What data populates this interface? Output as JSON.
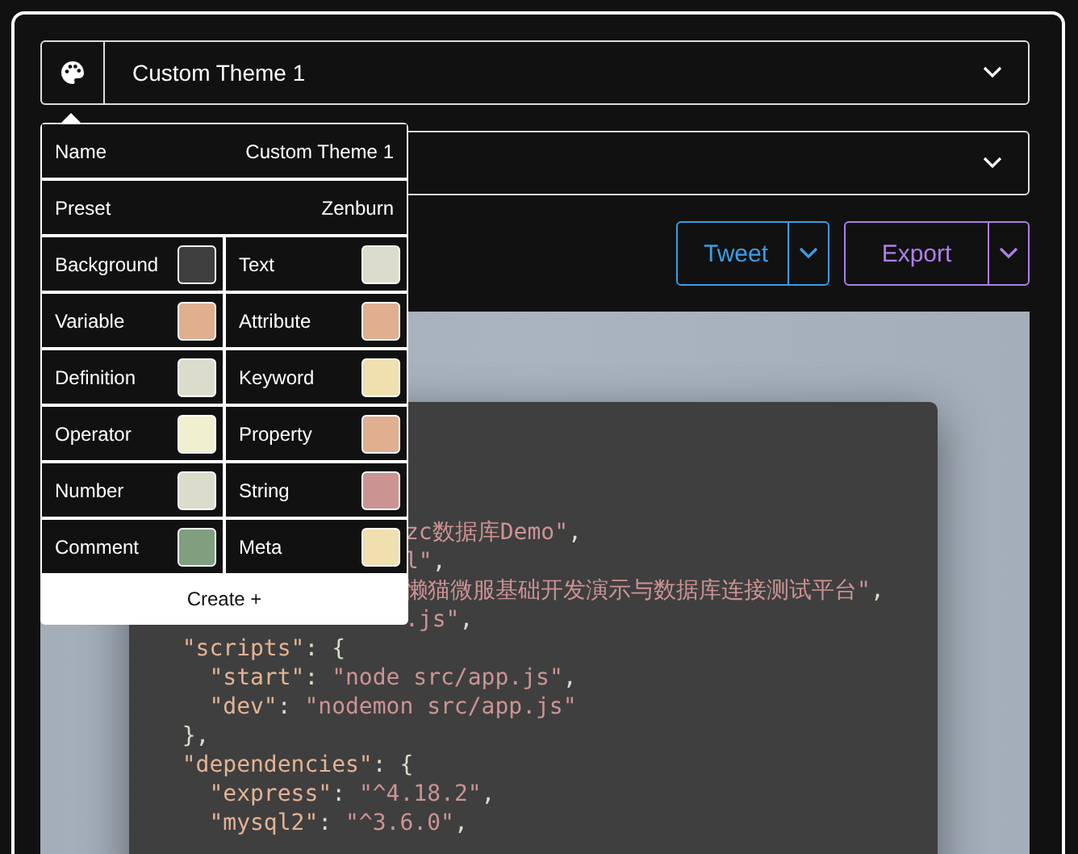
{
  "theme_select": {
    "value": "Custom Theme 1"
  },
  "buttons": [
    {
      "label": "Tweet",
      "color": "#3a9ee8"
    },
    {
      "label": "Export",
      "color": "#b07ee8"
    }
  ],
  "code_tail_lines": [
    {
      "tokens": [
        {
          "kind": "string",
          "text": "zc数据库Demo\""
        },
        {
          "kind": "punct",
          "text": ","
        }
      ]
    },
    {
      "tokens": [
        {
          "kind": "string",
          "text": "l\""
        },
        {
          "kind": "punct",
          "text": ","
        }
      ]
    },
    {
      "tokens": [
        {
          "kind": "string",
          "text": "懒猫微服基础开发演示与数据库连接测试平台\""
        },
        {
          "kind": "punct",
          "text": ","
        }
      ]
    },
    {
      "tokens": [
        {
          "kind": "string",
          "text": ".js\""
        },
        {
          "kind": "punct",
          "text": ","
        }
      ]
    }
  ],
  "code_lines": [
    {
      "tokens": [
        {
          "kind": "key",
          "text": "  \"scripts\""
        },
        {
          "kind": "punct",
          "text": ": {"
        }
      ]
    },
    {
      "tokens": [
        {
          "kind": "key",
          "text": "    \"start\""
        },
        {
          "kind": "punct",
          "text": ": "
        },
        {
          "kind": "string",
          "text": "\"node src/app.js\""
        },
        {
          "kind": "punct",
          "text": ","
        }
      ]
    },
    {
      "tokens": [
        {
          "kind": "key",
          "text": "    \"dev\""
        },
        {
          "kind": "punct",
          "text": ": "
        },
        {
          "kind": "string",
          "text": "\"nodemon src/app.js\""
        }
      ]
    },
    {
      "tokens": [
        {
          "kind": "punct",
          "text": "  },"
        }
      ]
    },
    {
      "tokens": [
        {
          "kind": "key",
          "text": "  \"dependencies\""
        },
        {
          "kind": "punct",
          "text": ": {"
        }
      ]
    },
    {
      "tokens": [
        {
          "kind": "key",
          "text": "    \"express\""
        },
        {
          "kind": "punct",
          "text": ": "
        },
        {
          "kind": "string",
          "text": "\"^4.18.2\""
        },
        {
          "kind": "punct",
          "text": ","
        }
      ]
    },
    {
      "tokens": [
        {
          "kind": "key",
          "text": "    \"mysql2\""
        },
        {
          "kind": "punct",
          "text": ": "
        },
        {
          "kind": "string",
          "text": "\"^3.6.0\""
        },
        {
          "kind": "punct",
          "text": ","
        }
      ]
    }
  ],
  "popup": {
    "name_label": "Name",
    "name_value": "Custom Theme 1",
    "preset_label": "Preset",
    "preset_value": "Zenburn",
    "colors": [
      {
        "label": "Background",
        "color": "#3f3f3f"
      },
      {
        "label": "Text",
        "color": "#dcdccc"
      },
      {
        "label": "Variable",
        "color": "#dfaf8f"
      },
      {
        "label": "Attribute",
        "color": "#dfaf8f"
      },
      {
        "label": "Definition",
        "color": "#dcdccc"
      },
      {
        "label": "Keyword",
        "color": "#f0dfaf"
      },
      {
        "label": "Operator",
        "color": "#f0efd0"
      },
      {
        "label": "Property",
        "color": "#dfaf8f"
      },
      {
        "label": "Number",
        "color": "#dcdccc"
      },
      {
        "label": "String",
        "color": "#cc9393"
      },
      {
        "label": "Comment",
        "color": "#7f9f7f"
      },
      {
        "label": "Meta",
        "color": "#f0dfaf"
      }
    ],
    "create_label": "Create +"
  }
}
